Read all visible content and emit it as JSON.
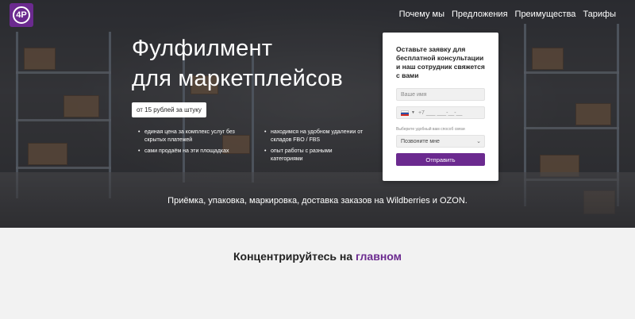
{
  "logo": {
    "mark": "4P"
  },
  "nav": {
    "items": [
      {
        "label": "Почему мы"
      },
      {
        "label": "Предложения"
      },
      {
        "label": "Преимущества"
      },
      {
        "label": "Тарифы"
      }
    ]
  },
  "hero": {
    "title_line1": "Фулфилмент",
    "title_line2": "для маркетплейсов",
    "price_badge": "от 15 рублей за штуку",
    "bullets_left": [
      "единая цена за комплекс услуг без скрытых платежей",
      "сами продаём на эти площадках"
    ],
    "bullets_right": [
      "находимся на удобном удалении от складов FBO / FBS",
      "опыт работы с разными категориями"
    ],
    "subtitle": "Приёмка, упаковка, маркировка, доставка заказов на Wildberries и OZON."
  },
  "form": {
    "title": "Оставьте заявку для бесплатной консультации и наш сотрудник свяжется с вами",
    "name_placeholder": "Ваше имя",
    "phone_placeholder": "+7 ___ ___-__-__",
    "contact_hint": "Выберите удобный вам способ связи",
    "contact_selected": "Позвоните мне",
    "submit_label": "Отправить"
  },
  "section": {
    "title_prefix": "Концентрируйтесь на",
    "title_accent": "главном"
  },
  "colors": {
    "accent": "#6b2a8f",
    "hero_overlay": "#2a2b2e",
    "page_bg": "#f2f2f2"
  }
}
